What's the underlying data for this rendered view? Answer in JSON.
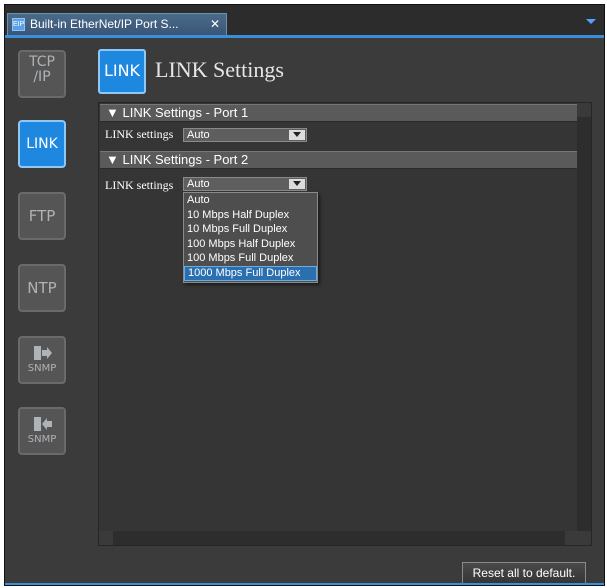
{
  "tab": {
    "title": "Built-in EtherNet/IP Port S...",
    "close": "✕",
    "icon_text": "EIP"
  },
  "nav": {
    "tcpip": "TCP\n/IP",
    "link": "LINK",
    "ftp": "FTP",
    "ntp": "NTP",
    "snmp": "SNMP",
    "snmp_trap": "SNMP"
  },
  "header": {
    "icon_text": "LINK",
    "title": "LINK Settings"
  },
  "sections": [
    {
      "title": "▼ LINK Settings - Port 1",
      "label": "LINK settings",
      "value": "Auto"
    },
    {
      "title": "▼ LINK Settings - Port 2",
      "label": "LINK settings",
      "value": "Auto"
    }
  ],
  "dropdown": {
    "options": [
      "Auto",
      "10 Mbps Half Duplex",
      "10 Mbps Full Duplex",
      "100 Mbps Half Duplex",
      "100 Mbps Full Duplex",
      "1000 Mbps Full Duplex"
    ],
    "highlighted": "1000 Mbps Full Duplex"
  },
  "footer": {
    "reset_label": "Reset all to default."
  },
  "colors": {
    "accent": "#1e88e0",
    "background": "#3b3b3b"
  }
}
